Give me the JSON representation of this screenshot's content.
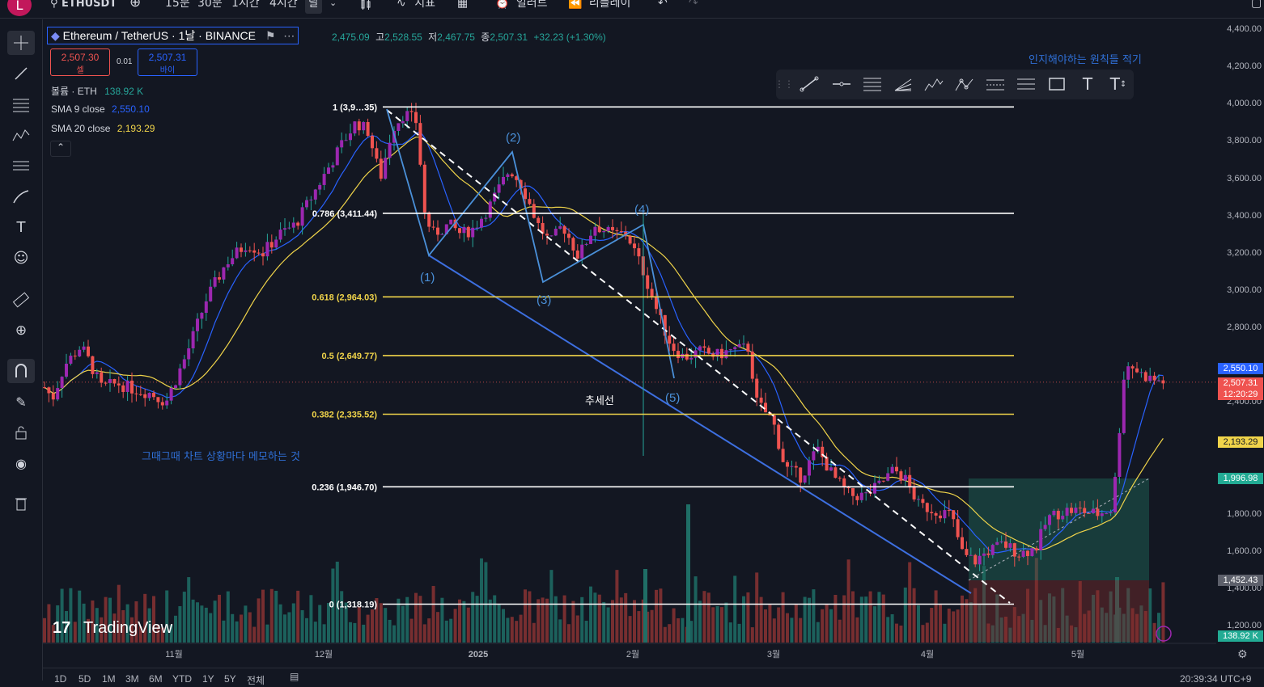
{
  "header": {
    "avatar_letter": "L",
    "symbol": "ETHUSDT",
    "intervals": [
      "15분",
      "30분",
      "1시간",
      "4시간",
      "날"
    ],
    "indicators_label": "지표",
    "alert_label": "얼러트",
    "replay_label": "리플레이"
  },
  "legend": {
    "title": "Ethereum / TetherUS · 1날 · BINANCE",
    "open": "2,475.09",
    "high_label": "고",
    "high": "2,528.55",
    "low_label": "저",
    "low": "2,467.75",
    "close_label": "종",
    "close": "2,507.31",
    "change": "+32.23 (+1.30%)",
    "sell_price": "2,507.30",
    "sell_label": "셀",
    "spread": "0.01",
    "buy_price": "2,507.31",
    "buy_label": "바이",
    "volume_label": "볼륨 · ETH",
    "volume_value": "138.92 K",
    "sma9_label": "SMA 9 close",
    "sma9_value": "2,550.10",
    "sma20_label": "SMA 20 close",
    "sma20_value": "2,193.29"
  },
  "annotations": {
    "memo_top": "인지해야하는 원칙들 적기",
    "memo_left": "그때그때 차트 상황마다 메모하는 것",
    "trendline_label": "추세선",
    "waves": [
      "(1)",
      "(2)",
      "(3)",
      "(4)",
      "(5)"
    ]
  },
  "fib": [
    {
      "label": "1 (3,9…35)",
      "price": 3981.35,
      "color": "#ffffff"
    },
    {
      "label": "0.786 (3,411.44)",
      "price": 3411.44,
      "color": "#ffffff"
    },
    {
      "label": "0.618 (2,964.03)",
      "price": 2964.03,
      "color": "#f0d44a"
    },
    {
      "label": "0.5 (2,649.77)",
      "price": 2649.77,
      "color": "#f0d44a"
    },
    {
      "label": "0.382 (2,335.52)",
      "price": 2335.52,
      "color": "#f0d44a"
    },
    {
      "label": "0.236 (1,946.70)",
      "price": 1946.7,
      "color": "#ffffff"
    },
    {
      "label": "0 (1,318.19)",
      "price": 1318.19,
      "color": "#ffffff"
    }
  ],
  "price_axis": {
    "ticks": [
      "4,400.00",
      "4,200.00",
      "4,000.00",
      "3,800.00",
      "3,600.00",
      "3,400.00",
      "3,200.00",
      "3,000.00",
      "2,800.00",
      "2,400.00",
      "1,800.00",
      "1,600.00",
      "1,400.00",
      "1,200.00"
    ],
    "badge_sma9": "2,550.10",
    "badge_price": "2,507.31",
    "badge_countdown": "12:20:29",
    "badge_sma20": "2,193.29",
    "badge_target": "1,996.98",
    "badge_stop": "1,452.43",
    "badge_volume": "138.92 K"
  },
  "time_axis": [
    "11월",
    "12월",
    "2025",
    "2월",
    "3월",
    "4월",
    "5월"
  ],
  "bottom": {
    "timeframes": [
      "1D",
      "5D",
      "1M",
      "3M",
      "6M",
      "YTD",
      "1Y",
      "5Y",
      "전체"
    ],
    "clock": "20:39:34 UTC+9"
  },
  "watermark": "TradingView",
  "colors": {
    "bg": "#131722",
    "up": "#26a69a",
    "down": "#ef5350",
    "candle_purple": "#9c27b0",
    "sma9": "#2962ff",
    "sma20": "#f0d44a",
    "wave": "#4a90d9",
    "trend_blue": "#3d6fe0"
  }
}
